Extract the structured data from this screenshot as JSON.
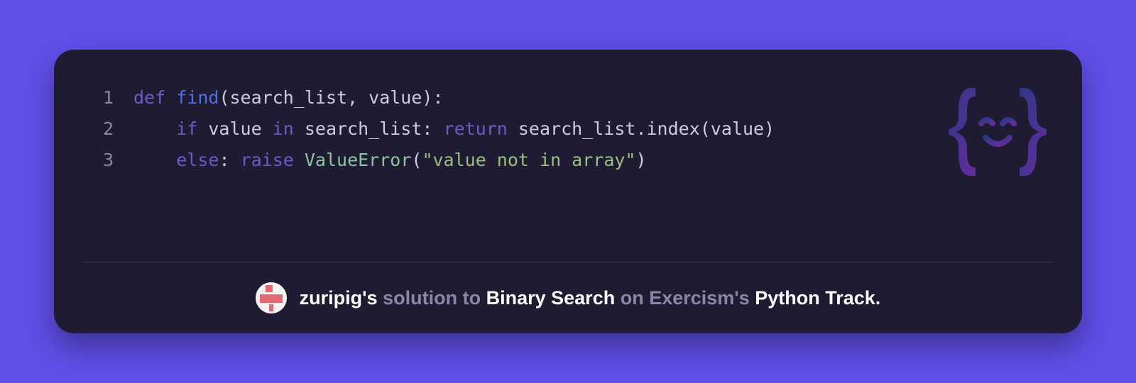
{
  "code": {
    "lines": [
      {
        "n": "1",
        "tokens": [
          {
            "cls": "tok-kw",
            "t": "def "
          },
          {
            "cls": "tok-fn",
            "t": "find"
          },
          {
            "cls": "tok-ident",
            "t": "(search_list, value):"
          }
        ]
      },
      {
        "n": "2",
        "tokens": [
          {
            "cls": "tok-ident",
            "t": "    "
          },
          {
            "cls": "tok-kw",
            "t": "if"
          },
          {
            "cls": "tok-ident",
            "t": " value "
          },
          {
            "cls": "tok-kw",
            "t": "in"
          },
          {
            "cls": "tok-ident",
            "t": " search_list: "
          },
          {
            "cls": "tok-kw",
            "t": "return"
          },
          {
            "cls": "tok-ident",
            "t": " search_list.index(value)"
          }
        ]
      },
      {
        "n": "3",
        "tokens": [
          {
            "cls": "tok-ident",
            "t": "    "
          },
          {
            "cls": "tok-kw",
            "t": "else"
          },
          {
            "cls": "tok-ident",
            "t": ": "
          },
          {
            "cls": "tok-kw",
            "t": "raise"
          },
          {
            "cls": "tok-ident",
            "t": " "
          },
          {
            "cls": "tok-class",
            "t": "ValueError"
          },
          {
            "cls": "tok-ident",
            "t": "("
          },
          {
            "cls": "tok-str",
            "t": "\"value not in array\""
          },
          {
            "cls": "tok-ident",
            "t": ")"
          }
        ]
      }
    ]
  },
  "footer": {
    "user": "zuripig's",
    "solution_word": "solution to",
    "exercise": "Binary Search",
    "on_word": "on Exercism's",
    "track": "Python Track."
  },
  "logo_name": "exercism-logo"
}
